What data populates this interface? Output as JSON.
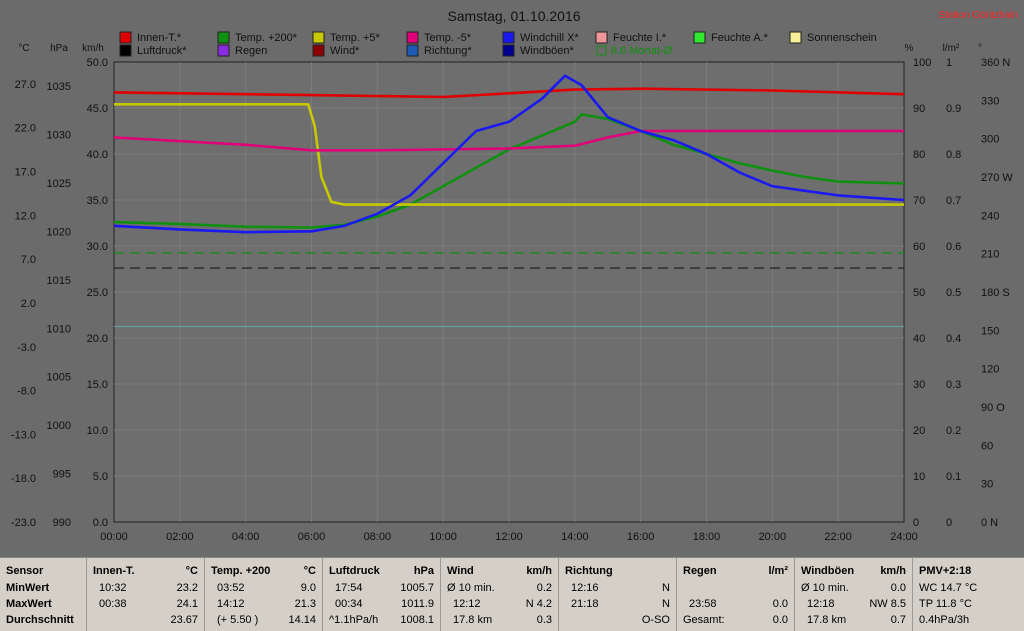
{
  "chart_data": {
    "type": "line",
    "title": "Samstag, 01.10.2016",
    "station": "Station Göritzhain",
    "x_ticks": [
      "00:00",
      "02:00",
      "04:00",
      "06:00",
      "08:00",
      "10:00",
      "12:00",
      "14:00",
      "16:00",
      "18:00",
      "20:00",
      "22:00",
      "24:00"
    ],
    "x_range_hours": [
      0,
      24
    ],
    "grid": true,
    "axes": {
      "temp": {
        "unit": "°C",
        "ticks": [
          "27.0",
          "22.0",
          "17.0",
          "12.0",
          "7.0",
          "2.0",
          "-3.0",
          "-8.0",
          "-13.0",
          "-18.0",
          "-23.0"
        ],
        "range": [
          -23,
          27
        ]
      },
      "pressure": {
        "unit": "hPa",
        "ticks": [
          "1035",
          "1030",
          "1025",
          "1020",
          "1015",
          "1010",
          "1005",
          "1000",
          "995",
          "990"
        ],
        "range": [
          990,
          1040
        ]
      },
      "wind": {
        "unit": "km/h",
        "ticks": [
          "50.0",
          "45.0",
          "40.0",
          "35.0",
          "30.0",
          "25.0",
          "20.0",
          "15.0",
          "10.0",
          "5.0",
          "0.0"
        ],
        "range": [
          0,
          50
        ]
      },
      "humidity": {
        "unit": "%",
        "ticks": [
          "100",
          "90",
          "80",
          "70",
          "60",
          "50",
          "40",
          "30",
          "20",
          "10",
          "0"
        ],
        "range": [
          0,
          100
        ]
      },
      "rain": {
        "unit": "l/m²",
        "ticks": [
          "1",
          "0.9",
          "0.8",
          "0.7",
          "0.6",
          "0.5",
          "0.4",
          "0.3",
          "0.2",
          "0.1",
          "0"
        ],
        "range": [
          0,
          1
        ]
      },
      "direction": {
        "unit": "°",
        "ticks": [
          "360 N",
          "330",
          "300",
          "270 W",
          "240",
          "210",
          "180 S",
          "150",
          "120",
          "90 O",
          "60",
          "30",
          "0 N"
        ],
        "range": [
          0,
          360
        ]
      }
    },
    "legend": [
      {
        "name": "Innen-T.*",
        "color": "#e00000"
      },
      {
        "name": "Temp. +200*",
        "color": "#109010"
      },
      {
        "name": "Temp. +5*",
        "color": "#c8c800"
      },
      {
        "name": "Temp. -5*",
        "color": "#e0007a"
      },
      {
        "name": "Windchill X*",
        "color": "#1a1af0"
      },
      {
        "name": "Feuchte I.*",
        "color": "#f09898"
      },
      {
        "name": "Feuchte A.*",
        "color": "#30e830"
      },
      {
        "name": "Sonnenschein",
        "color": "#f8f098"
      },
      {
        "name": "Luftdruck*",
        "color": "#000000"
      },
      {
        "name": "Regen",
        "color": "#8a2be2"
      },
      {
        "name": "Wind*",
        "color": "#8b0000"
      },
      {
        "name": "Richtung*",
        "color": "#1e5ab4"
      },
      {
        "name": "Windböen*",
        "color": "#000090"
      },
      {
        "name": "8.6 Monat-Ø",
        "color": "#109010"
      }
    ],
    "series": [
      {
        "name": "Innen-T.*",
        "axis": "temp",
        "points": [
          [
            0,
            23.7
          ],
          [
            6,
            23.4
          ],
          [
            10,
            23.2
          ],
          [
            12,
            23.6
          ],
          [
            14,
            24.0
          ],
          [
            16,
            24.1
          ],
          [
            20,
            23.9
          ],
          [
            24,
            23.5
          ]
        ]
      },
      {
        "name": "Temp. +200*",
        "axis": "temp",
        "points": [
          [
            0,
            9.6
          ],
          [
            2,
            9.4
          ],
          [
            4,
            9.1
          ],
          [
            6,
            9.0
          ],
          [
            7,
            9.3
          ],
          [
            8,
            10.2
          ],
          [
            9,
            11.5
          ],
          [
            10,
            13.5
          ],
          [
            11,
            15.5
          ],
          [
            12,
            17.5
          ],
          [
            13,
            19.0
          ],
          [
            14,
            20.5
          ],
          [
            14.2,
            21.3
          ],
          [
            15,
            20.8
          ],
          [
            16,
            19.5
          ],
          [
            17,
            18.0
          ],
          [
            18,
            17.0
          ],
          [
            19,
            16.0
          ],
          [
            20,
            15.2
          ],
          [
            21,
            14.5
          ],
          [
            22,
            14.0
          ],
          [
            24,
            13.8
          ]
        ]
      },
      {
        "name": "Temp. +5*",
        "axis": "temp",
        "points": [
          [
            0,
            22.4
          ],
          [
            5.9,
            22.4
          ],
          [
            6.1,
            20.0
          ],
          [
            6.3,
            14.5
          ],
          [
            6.6,
            11.8
          ],
          [
            7,
            11.5
          ],
          [
            24,
            11.5
          ]
        ]
      },
      {
        "name": "Temp. -5*",
        "axis": "temp",
        "points": [
          [
            0,
            18.8
          ],
          [
            4,
            18.0
          ],
          [
            6,
            17.4
          ],
          [
            8,
            17.4
          ],
          [
            12,
            17.6
          ],
          [
            14,
            17.9
          ],
          [
            15,
            18.8
          ],
          [
            16,
            19.5
          ],
          [
            24,
            19.5
          ]
        ]
      },
      {
        "name": "Windchill X*",
        "axis": "temp",
        "points": [
          [
            0,
            9.2
          ],
          [
            2,
            8.8
          ],
          [
            4,
            8.5
          ],
          [
            6,
            8.6
          ],
          [
            7,
            9.2
          ],
          [
            8,
            10.5
          ],
          [
            9,
            12.5
          ],
          [
            10,
            16.0
          ],
          [
            11,
            19.5
          ],
          [
            12,
            20.5
          ],
          [
            13,
            23.0
          ],
          [
            13.7,
            25.5
          ],
          [
            14.2,
            24.5
          ],
          [
            15,
            21.0
          ],
          [
            16,
            19.5
          ],
          [
            17,
            18.5
          ],
          [
            18,
            17.0
          ],
          [
            19,
            15.0
          ],
          [
            20,
            13.5
          ],
          [
            21,
            13.0
          ],
          [
            22,
            12.5
          ],
          [
            24,
            12.0
          ]
        ]
      }
    ],
    "stats": {
      "headers": {
        "sensor": "Sensor",
        "innen": "Innen-T.",
        "innen_unit": "°C",
        "temp200": "Temp. +200",
        "temp200_unit": "°C",
        "pressure": "Luftdruck",
        "pressure_unit": "hPa",
        "wind": "Wind",
        "wind_unit": "km/h",
        "dir": "Richtung",
        "rain": "Regen",
        "rain_unit": "l/m²",
        "gust": "Windböen",
        "gust_unit": "km/h",
        "pmv": "PMV+2:18"
      },
      "row_labels": [
        "MinWert",
        "MaxWert",
        "Durchschnitt"
      ],
      "innen": [
        [
          "10:32",
          "23.2"
        ],
        [
          "00:38",
          "24.1"
        ],
        [
          "",
          "23.67"
        ]
      ],
      "temp200": [
        [
          "03:52",
          "9.0"
        ],
        [
          "14:12",
          "21.3"
        ],
        [
          "(+ 5.50 )",
          "14.14"
        ]
      ],
      "pressure": [
        [
          "17:54",
          "1005.7"
        ],
        [
          "00:34",
          "1011.9"
        ],
        [
          "^1.1hPa/h",
          "1008.1"
        ]
      ],
      "wind": [
        [
          "Ø 10 min.",
          "0.2"
        ],
        [
          "12:12",
          "N 4.2"
        ],
        [
          "17.8 km",
          "0.3"
        ]
      ],
      "dir": [
        [
          "12:16",
          "N"
        ],
        [
          "21:18",
          "N"
        ],
        [
          "",
          "O-SO"
        ]
      ],
      "rain": [
        [
          "",
          ""
        ],
        [
          "23:58",
          "0.0"
        ],
        [
          "Gesamt:",
          "0.0"
        ]
      ],
      "gust": [
        [
          "Ø 10 min.",
          "0.0"
        ],
        [
          "12:18",
          "NW 8.5"
        ],
        [
          "17.8 km",
          "0.7"
        ]
      ],
      "pmv": [
        "WC 14.7 °C",
        "TP 11.8 °C",
        "0.4hPa/3h"
      ]
    }
  }
}
